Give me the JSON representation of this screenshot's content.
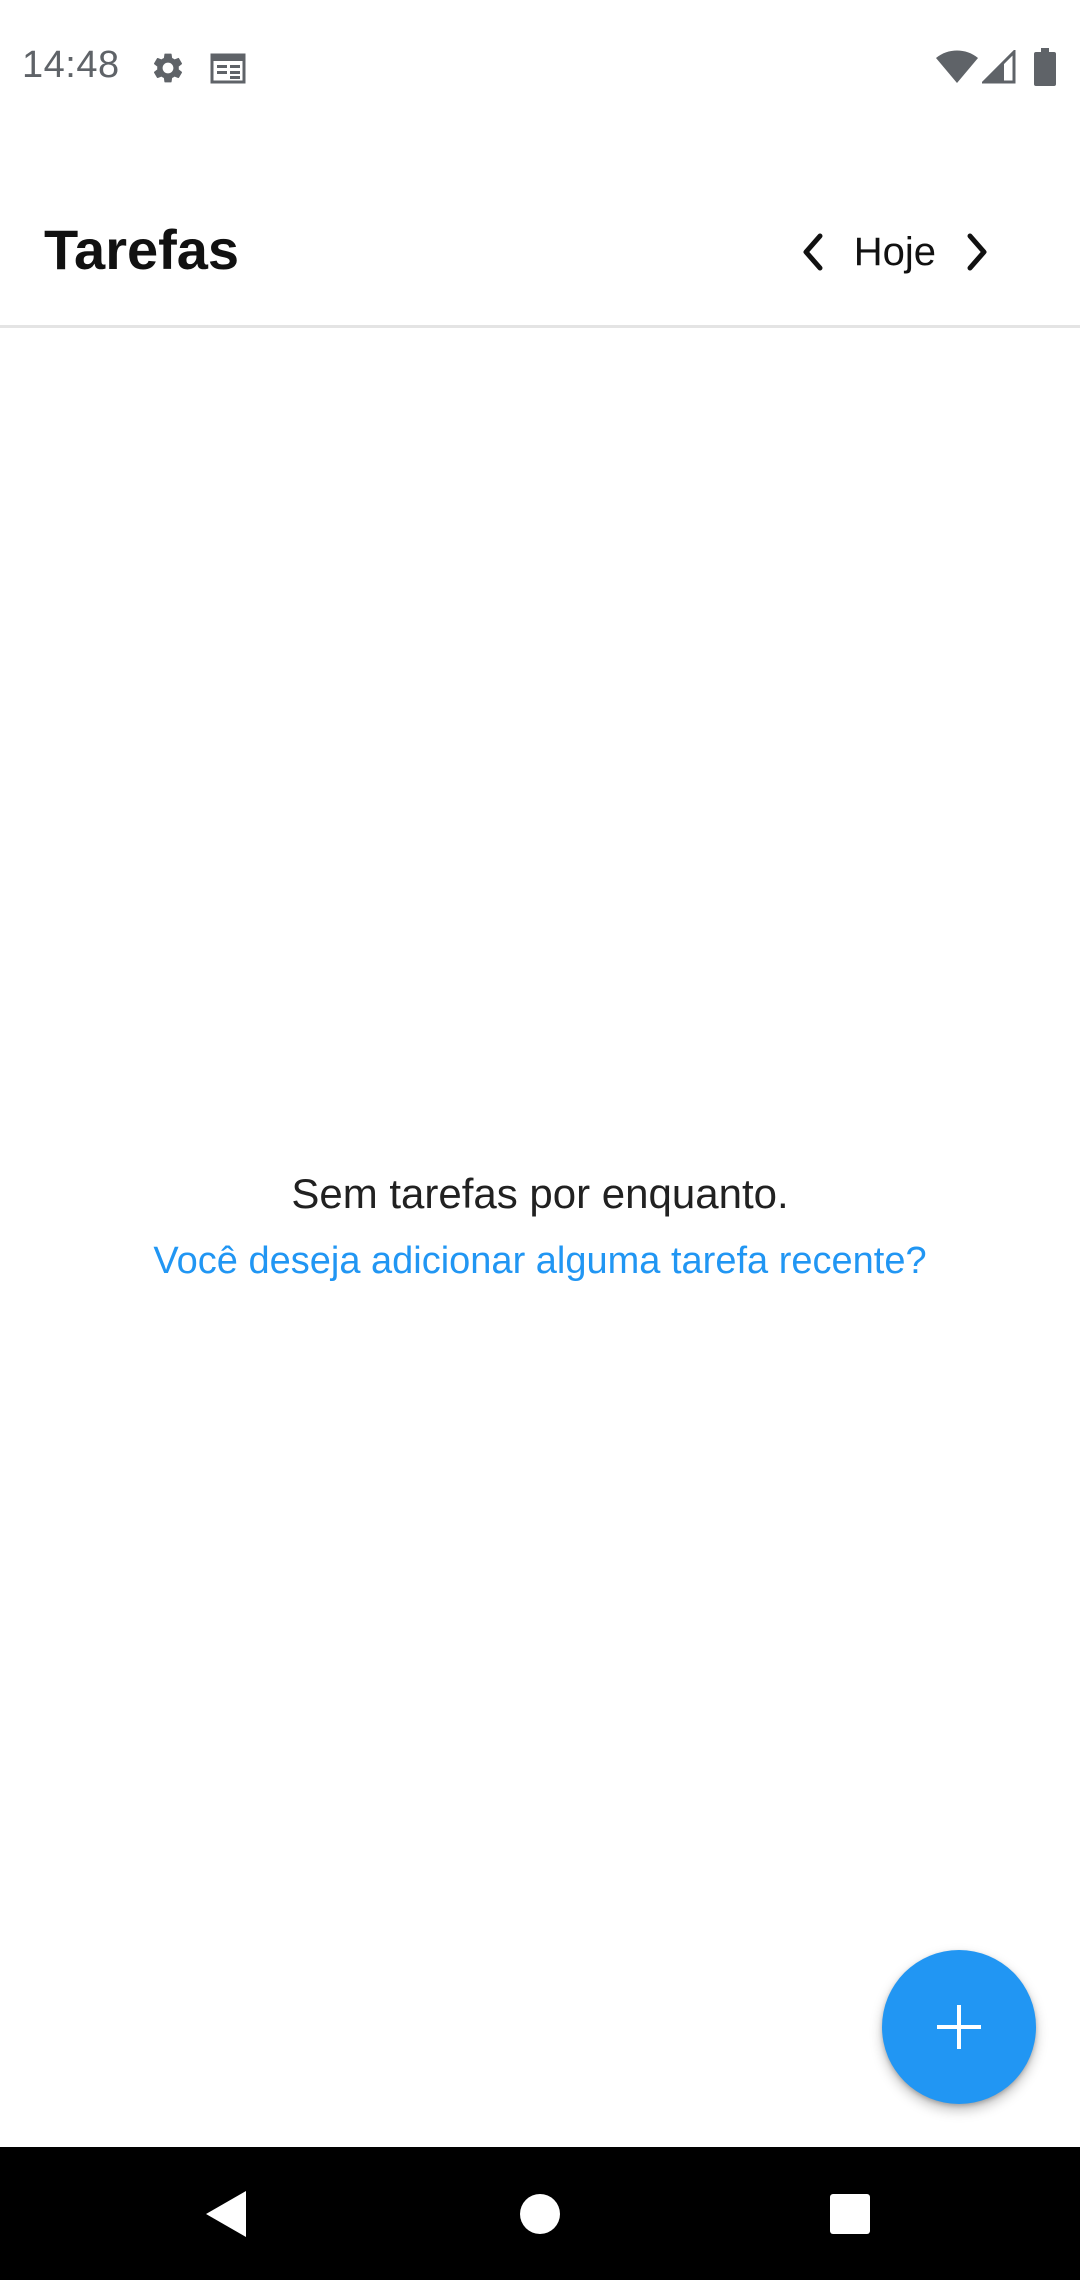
{
  "status_bar": {
    "time": "14:48",
    "icons": [
      "settings-gear-icon",
      "calendar-icon",
      "wifi-icon",
      "cell-signal-icon",
      "battery-icon"
    ]
  },
  "app_bar": {
    "title": "Tarefas",
    "date_label": "Hoje"
  },
  "empty_state": {
    "message": "Sem tarefas por enquanto.",
    "link_text": "Você deseja adicionar alguma tarefa recente?"
  },
  "fab": {
    "icon": "plus-icon"
  },
  "navigation_bar": {
    "buttons": [
      "back-icon",
      "home-icon",
      "recents-icon"
    ]
  },
  "colors": {
    "accent": "#2196f3",
    "title_text": "#111111",
    "status_text": "#5f6368",
    "nav_bar": "#000000"
  }
}
